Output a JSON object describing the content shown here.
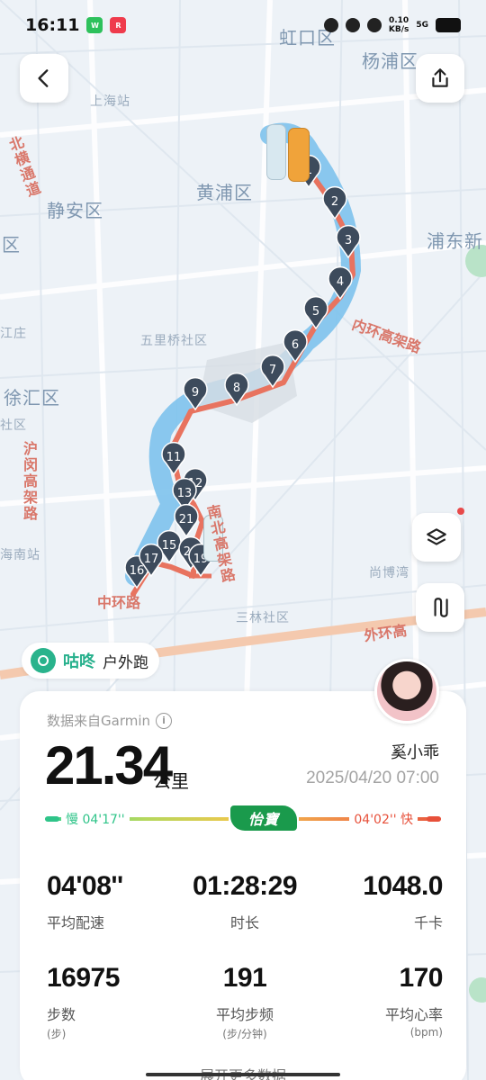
{
  "status_bar": {
    "time": "16:11",
    "net_speed": "0.10",
    "net_unit": "KB/s",
    "network": "5G"
  },
  "map": {
    "districts": [
      "虹口区",
      "杨浦区",
      "上海站",
      "黄浦区",
      "静安区",
      "浦东新",
      "五里桥社区",
      "徐汇区",
      "区",
      "江庄",
      "社区",
      "尚博湾",
      "三林社区",
      "海南站"
    ],
    "roads": [
      "北横通道",
      "内环高架路",
      "沪闵高架路",
      "南北高架路",
      "中环路",
      "外环高"
    ],
    "markers": [
      "1",
      "2",
      "3",
      "4",
      "5",
      "6",
      "7",
      "8",
      "9",
      "11",
      "12",
      "13",
      "21",
      "15",
      "16",
      "17",
      "20",
      "19"
    ],
    "route_color": "#e8735f",
    "marker_color": "#3d4b5c"
  },
  "buttons": {
    "back_icon": "chevron-left-icon",
    "share_icon": "share-icon",
    "layers_icon": "layers-icon",
    "route_icon": "route-icon"
  },
  "brand": {
    "name": "咕咚",
    "sport": "户外跑"
  },
  "card": {
    "source": "数据来自Garmin",
    "distance": "21.34",
    "distance_unit": "公里",
    "username": "奚小乖",
    "datetime": "2025/04/20 07:00",
    "pace_slow": "慢 04'17''",
    "pace_fast": "04'02'' 快",
    "sponsor": "怡寶",
    "stats": [
      {
        "value": "04'08''",
        "label": "平均配速",
        "sub": ""
      },
      {
        "value": "01:28:29",
        "label": "时长",
        "sub": ""
      },
      {
        "value": "1048.0",
        "label": "千卡",
        "sub": ""
      },
      {
        "value": "16975",
        "label": "步数",
        "sub": "(步)"
      },
      {
        "value": "191",
        "label": "平均步频",
        "sub": "(步/分钟)"
      },
      {
        "value": "170",
        "label": "平均心率",
        "sub": "(bpm)"
      }
    ],
    "more": "展开更多数据"
  }
}
